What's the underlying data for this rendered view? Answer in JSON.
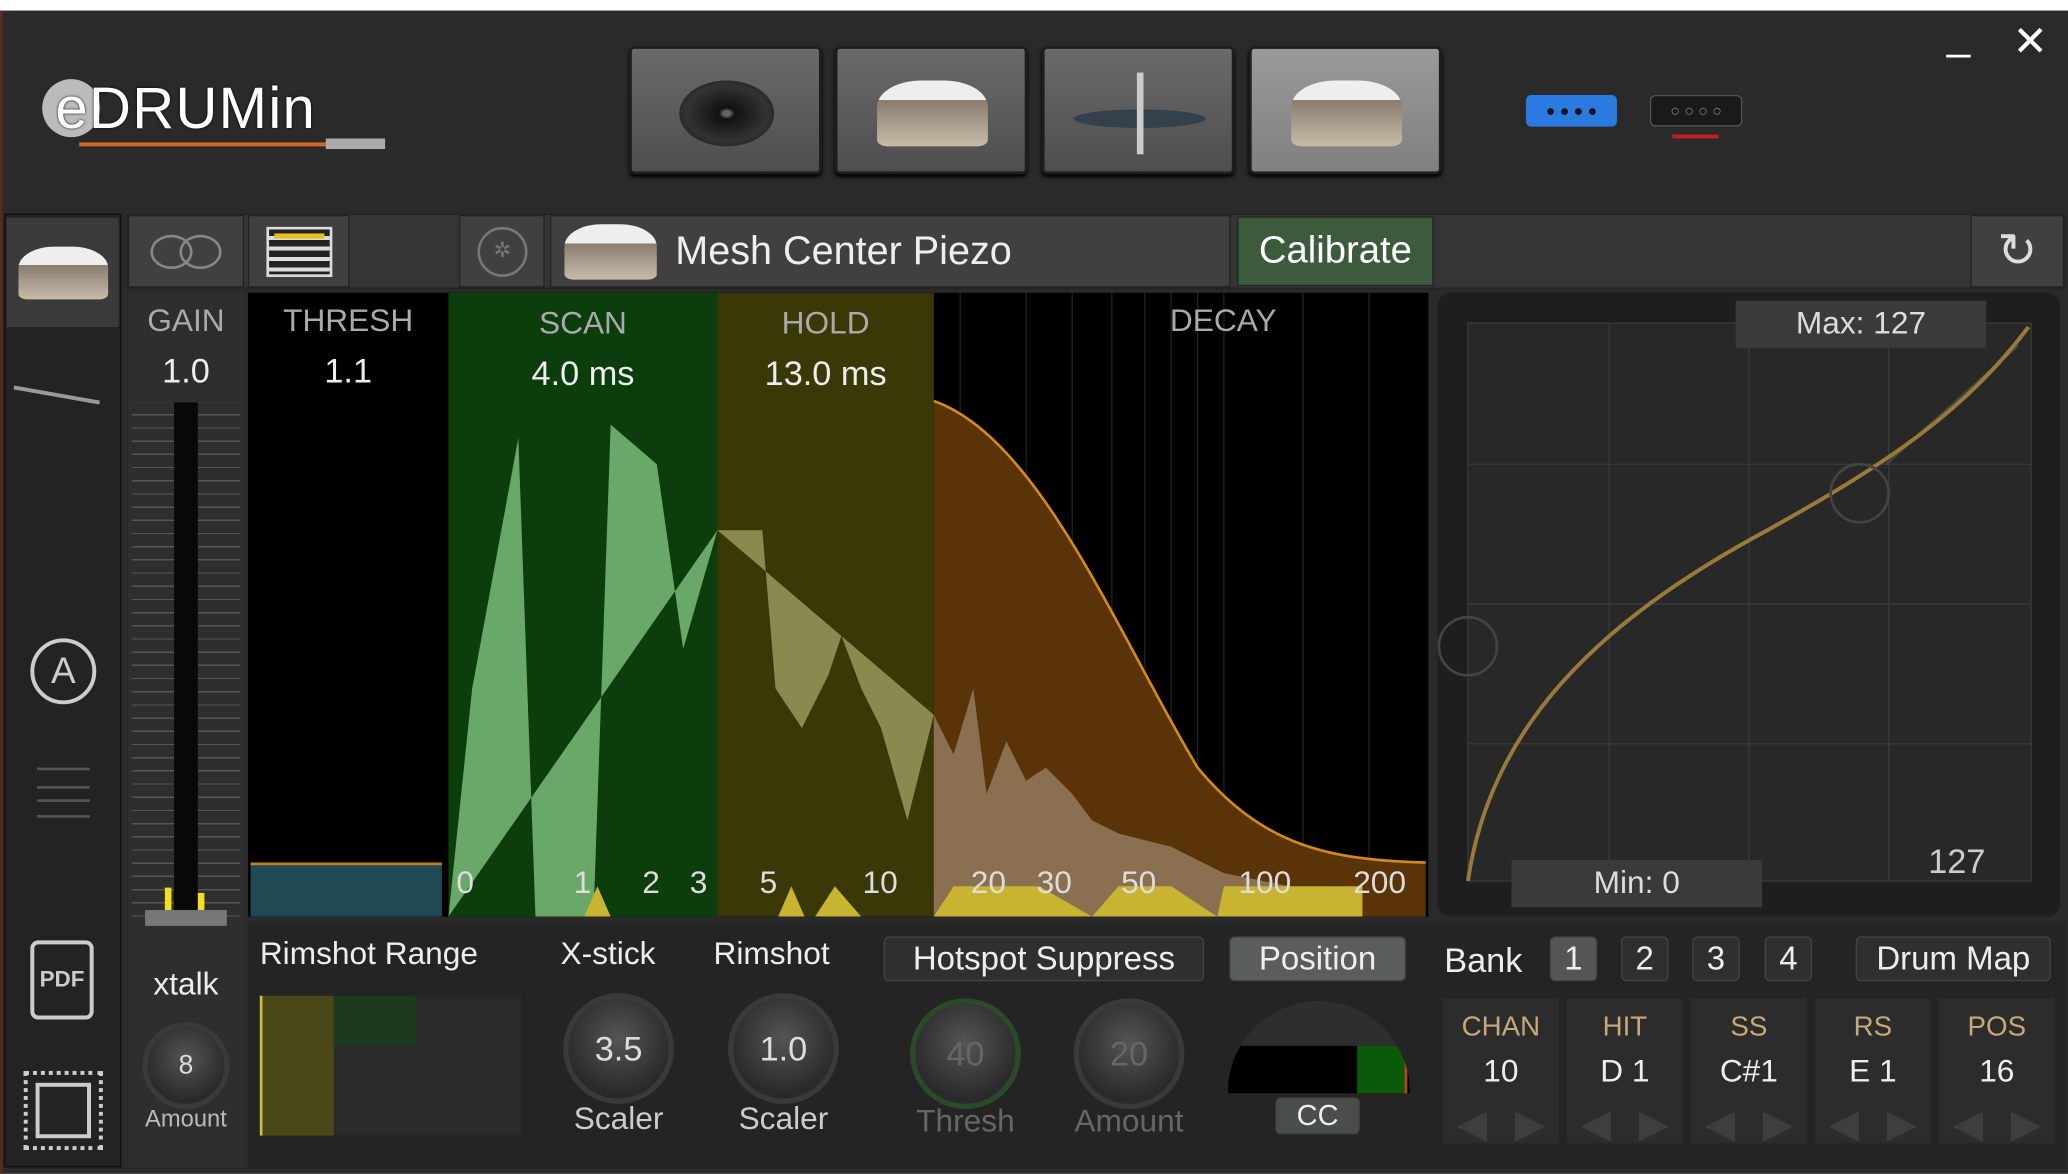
{
  "app": {
    "logo_text": "eDRUMin",
    "minimize": "_",
    "close": "✕"
  },
  "top_pads": [
    {
      "icon": "cymbal-icon"
    },
    {
      "icon": "snare-drum-icon"
    },
    {
      "icon": "hihat-icon"
    },
    {
      "icon": "snare-drum-icon",
      "selected": true
    }
  ],
  "ports": [
    {
      "icon": "port-icon",
      "color": "#2a7ae0",
      "active": true
    },
    {
      "icon": "port-icon",
      "color": "#1e1e1e",
      "active": false
    }
  ],
  "toolbar": {
    "input_name": "Mesh Center Piezo",
    "calibrate": "Calibrate"
  },
  "gain": {
    "label": "GAIN",
    "value": "1.0"
  },
  "graph": {
    "thresh_label": "THRESH",
    "thresh_value": "1.1",
    "scan_label": "SCAN",
    "scan_value": "4.0 ms",
    "hold_label": "HOLD",
    "hold_value": "13.0 ms",
    "decay_label": "DECAY",
    "ticks": [
      "0",
      "1",
      "2",
      "3",
      "5",
      "10",
      "20",
      "30",
      "50",
      "100",
      "200"
    ],
    "colors": {
      "scan": "#0c3d0c",
      "hold": "#3a3806",
      "decay_curve": "#d08a20"
    }
  },
  "curve": {
    "max": "Max: 127",
    "min": "Min: 0",
    "value": "127"
  },
  "xtalk": {
    "label": "xtalk",
    "amount_value": "8",
    "amount_label": "Amount"
  },
  "bottom": {
    "rimshot_range": "Rimshot Range",
    "xstick": "X-stick",
    "xstick_value": "3.5",
    "xstick_sub": "Scaler",
    "rimshot": "Rimshot",
    "rimshot_value": "1.0",
    "rimshot_sub": "Scaler",
    "hotspot": "Hotspot Suppress",
    "hotspot_thresh": "40",
    "hotspot_thresh_label": "Thresh",
    "hotspot_amount": "20",
    "hotspot_amount_label": "Amount",
    "position": "Position",
    "cc": "CC",
    "bank_label": "Bank",
    "banks": [
      "1",
      "2",
      "3",
      "4"
    ],
    "selected_bank": "1",
    "drum_map": "Drum Map",
    "cells": [
      {
        "h": "CHAN",
        "v": "10"
      },
      {
        "h": "HIT",
        "v": "D 1"
      },
      {
        "h": "SS",
        "v": "C#1"
      },
      {
        "h": "RS",
        "v": "E 1"
      },
      {
        "h": "POS",
        "v": "16"
      }
    ]
  }
}
